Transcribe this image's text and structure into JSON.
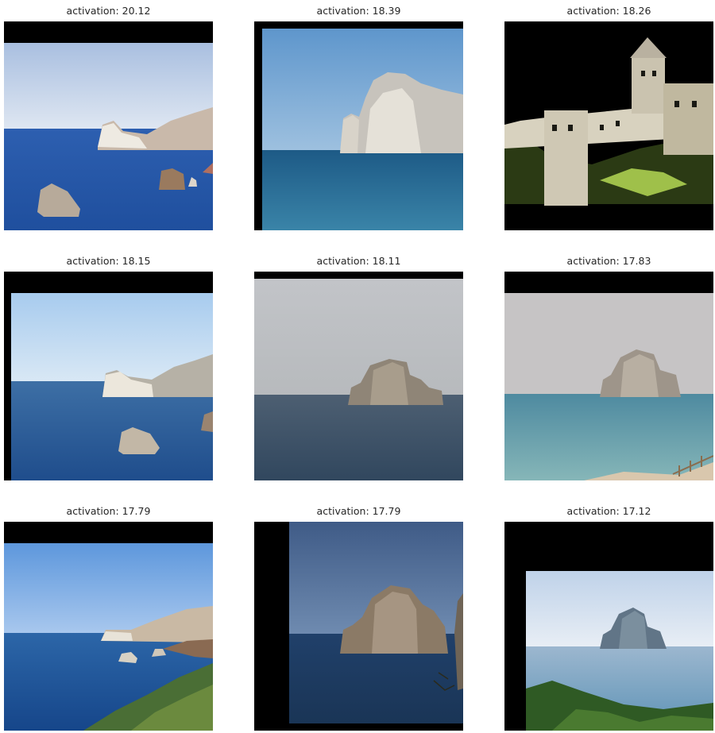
{
  "grid": {
    "panels": [
      {
        "title": "activation: 20.12",
        "subject": "sea-stacks-coast-photo"
      },
      {
        "title": "activation: 18.39",
        "subject": "sea-stack-close-photo"
      },
      {
        "title": "activation: 18.26",
        "subject": "castle-night-photo"
      },
      {
        "title": "activation: 18.15",
        "subject": "sea-stacks-coast-photo"
      },
      {
        "title": "activation: 18.11",
        "subject": "sea-stack-overcast-photo"
      },
      {
        "title": "activation: 17.83",
        "subject": "sea-stack-shore-photo"
      },
      {
        "title": "activation: 17.79",
        "subject": "coastal-cliffs-photo"
      },
      {
        "title": "activation: 17.79",
        "subject": "sea-stack-evening-photo"
      },
      {
        "title": "activation: 17.12",
        "subject": "sea-stack-bright-photo"
      }
    ]
  }
}
